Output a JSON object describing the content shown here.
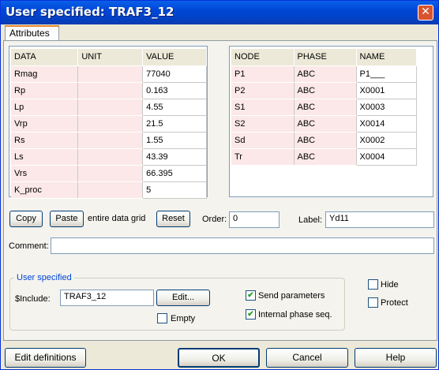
{
  "window": {
    "title": "User specified: TRAF3_12",
    "close_icon": "close-icon"
  },
  "tabs": [
    {
      "label": "Attributes"
    }
  ],
  "data_grid": {
    "headers": [
      "DATA",
      "UNIT",
      "VALUE"
    ],
    "rows": [
      {
        "data": "Rmag",
        "unit": "",
        "value": "77040"
      },
      {
        "data": "Rp",
        "unit": "",
        "value": "0.163"
      },
      {
        "data": "Lp",
        "unit": "",
        "value": "4.55"
      },
      {
        "data": "Vrp",
        "unit": "",
        "value": "21.5"
      },
      {
        "data": "Rs",
        "unit": "",
        "value": "1.55"
      },
      {
        "data": "Ls",
        "unit": "",
        "value": "43.39"
      },
      {
        "data": "Vrs",
        "unit": "",
        "value": "66.395"
      },
      {
        "data": "K_proc",
        "unit": "",
        "value": "5"
      }
    ]
  },
  "node_grid": {
    "headers": [
      "NODE",
      "PHASE",
      "NAME"
    ],
    "rows": [
      {
        "node": "P1",
        "phase": "ABC",
        "name": "P1___"
      },
      {
        "node": "P2",
        "phase": "ABC",
        "name": "X0001"
      },
      {
        "node": "S1",
        "phase": "ABC",
        "name": "X0003"
      },
      {
        "node": "S2",
        "phase": "ABC",
        "name": "X0014"
      },
      {
        "node": "Sd",
        "phase": "ABC",
        "name": "X0002"
      },
      {
        "node": "Tr",
        "phase": "ABC",
        "name": "X0004"
      }
    ]
  },
  "toolbar": {
    "copy_label": "Copy",
    "paste_label": "Paste",
    "entire_grid_text": "entire data grid",
    "reset_label": "Reset",
    "order_label": "Order:",
    "order_value": "0",
    "label_label": "Label:",
    "label_value": "Yd11"
  },
  "comment": {
    "label": "Comment:",
    "value": ""
  },
  "user_specified": {
    "group_title": "User specified",
    "include_label": "$Include:",
    "include_value": "TRAF3_12",
    "edit_label": "Edit...",
    "empty_label": "Empty",
    "empty_checked": false,
    "send_parameters_label": "Send parameters",
    "send_parameters_checked": true,
    "internal_phase_label": "Internal phase seq.",
    "internal_phase_checked": true
  },
  "options": {
    "hide_label": "Hide",
    "hide_checked": false,
    "protect_label": "Protect",
    "protect_checked": false
  },
  "footer": {
    "edit_definitions_label": "Edit definitions",
    "ok_label": "OK",
    "cancel_label": "Cancel",
    "help_label": "Help"
  }
}
